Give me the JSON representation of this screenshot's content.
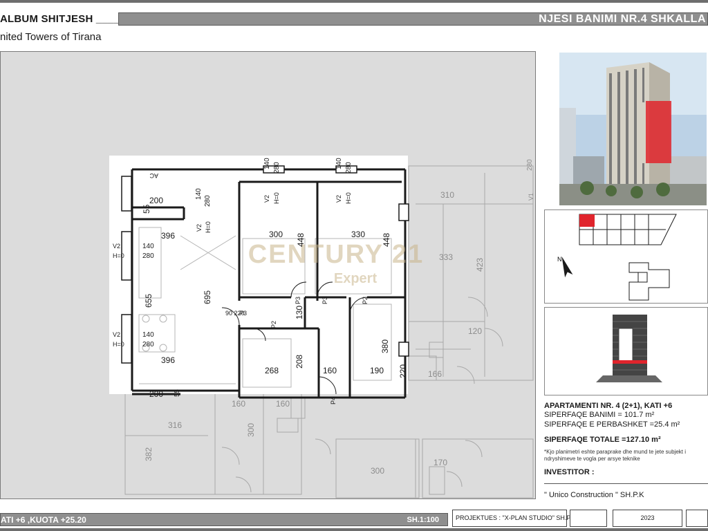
{
  "header": {
    "album_title": "ALBUM SHITJESH ____",
    "project_name": "nited  Towers of Tirana",
    "unit_title": "NJESI BANIMI NR.4 SHKALLA"
  },
  "plan": {
    "watermark_main": "CENTURY 21",
    "watermark_sub": "Expert",
    "dims": {
      "d200_top": "200",
      "d55_top": "55",
      "d396_top": "396",
      "d396_bot": "396",
      "d655": "655",
      "d695": "695",
      "d300_room": "300",
      "d330_room": "330",
      "d448_a": "448",
      "d448_b": "448",
      "d130": "130",
      "d268": "268",
      "d208": "208",
      "d160": "160",
      "d190": "190",
      "d380": "380",
      "d220": "220",
      "d200_bot": "200",
      "d55_bot": "55",
      "d140_a": "140",
      "d280_a": "280",
      "d140_b": "140",
      "d280_b": "280",
      "d140_c": "140",
      "d280_c": "280",
      "d140_w1": "140",
      "d280_w1": "280",
      "d140_w2": "140",
      "d280_w2": "280",
      "ghost_310": "310",
      "ghost_333": "333",
      "ghost_423": "423",
      "ghost_120": "120",
      "ghost_166": "166",
      "ghost_160a": "160",
      "ghost_160b": "160",
      "ghost_316": "316",
      "ghost_300a": "300",
      "ghost_382": "382",
      "ghost_170": "170",
      "ghost_300b": "300",
      "ghost_280": "280"
    },
    "labels": {
      "v2": "V2",
      "h0": "H=0",
      "ac": "AC",
      "p3": "P3",
      "p2": "P2",
      "p4": "P4",
      "v1": "V1",
      "door_90_220": "90 220",
      "door_80_220": "80 220",
      "door_100_220": "100 220"
    }
  },
  "info": {
    "apartment_title": "APARTAMENTI NR. 4 (2+1), KATI +6",
    "living_area": "SIPERFAQE BANIMI = 101.7 m²",
    "common_area": "SIPERFAQE E PERBASHKET =25.4 m²",
    "total_area": "SIPERFAQE TOTALE =127.10 m²",
    "note": "*Kjo planimetri eshte paraprake dhe mund te jete subjekt i ndryshimeve te vogla per arsye teknike",
    "investor_label": "INVESTITOR :",
    "investor_name": "\" Unico Construction \" SH.P.K"
  },
  "keyplan": {
    "north_label": "N"
  },
  "footer": {
    "floor_info": "ATI +6 ,KUOTA +25.20",
    "scale": "SH.1:100",
    "designer": "PROJEKTUES : \"X-PLAN STUDIO\" SH.P.K",
    "year": "2023"
  },
  "colors": {
    "title_bar": "#8f8f8f",
    "plan_background": "#dcdcdc",
    "highlight_red": "#e0242c",
    "wall": "#1a1a1a",
    "ghost_line": "#a8a8a8",
    "watermark": "#c8b48a"
  }
}
